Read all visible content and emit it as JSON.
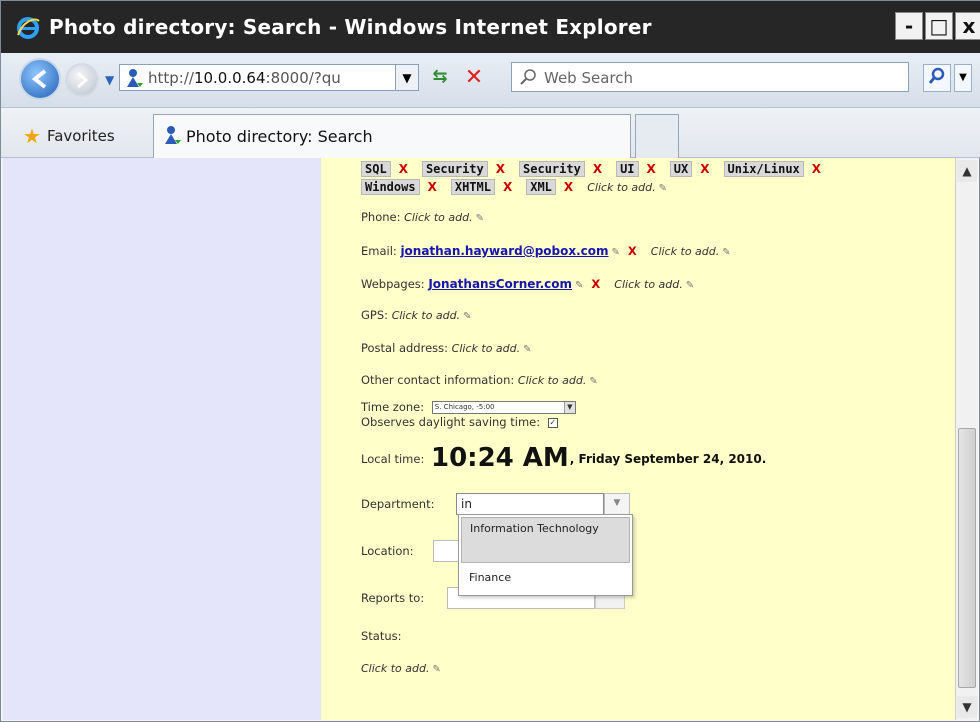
{
  "window": {
    "title": "Photo directory: Search - Windows Internet Explorer",
    "buttons": {
      "minimize": "-",
      "maximize": "□",
      "close": "x"
    }
  },
  "navbar": {
    "address_prefix": "http://",
    "address_host": "10.0.0.64",
    "address_rest": ":8000/?qu",
    "search_placeholder": "Web Search"
  },
  "favorites_bar": {
    "favorites_label": "Favorites",
    "tab_label": "Photo directory: Search"
  },
  "profile": {
    "tags_row1": [
      "SQL",
      "Security",
      "Security",
      "UI",
      "UX",
      "Unix/Linux"
    ],
    "tags_row2": [
      "Windows",
      "XHTML",
      "XML"
    ],
    "tag_remove": "X",
    "click_to_add": "Click to add.",
    "phone_label": "Phone:",
    "email_label": "Email:",
    "email_value": "jonathan.hayward@pobox.com",
    "webpages_label": "Webpages:",
    "webpage_value": "JonathansCorner.com",
    "gps_label": "GPS:",
    "postal_label": "Postal address:",
    "other_label": "Other contact information:",
    "timezone_label": "Time zone:",
    "timezone_value": "S. Chicago, -5:00",
    "dst_label": "Observes daylight saving time:",
    "dst_check": "✓",
    "local_time_label": "Local time:",
    "local_time_value": "10:24 AM",
    "local_date_value": ", Friday September 24, 2010.",
    "department_label": "Department:",
    "department_value": "in",
    "location_label": "Location:",
    "reports_to_label": "Reports to:",
    "status_label": "Status:",
    "dropdown_options": [
      "Information Technology",
      "Finance"
    ]
  }
}
